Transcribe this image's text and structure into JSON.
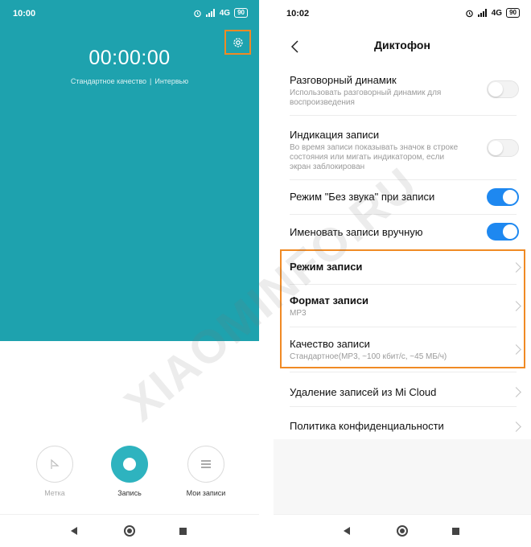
{
  "left": {
    "status": {
      "time": "10:00",
      "network": "4G",
      "battery": "90"
    },
    "timer": "00:00:00",
    "quality": "Стандартное качество",
    "separator": "|",
    "mode": "Интервью",
    "controls": {
      "mark": "Метка",
      "record": "Запись",
      "recordings": "Мои записи"
    },
    "colors": {
      "teal": "#1ea2ae",
      "record": "#2eb3bf",
      "highlight": "#f08a24"
    }
  },
  "right": {
    "status": {
      "time": "10:02",
      "network": "4G",
      "battery": "90"
    },
    "title": "Диктофон",
    "rows": [
      {
        "title": "Разговорный динамик",
        "subtitle": "Использовать разговорный динамик для воспроизведения",
        "toggle": false
      },
      {
        "title": "Индикация записи",
        "subtitle": "Во время записи показывать значок в строке состояния или мигать индикатором, если экран заблокирован",
        "toggle": false
      },
      {
        "title": "Режим \"Без звука\" при записи",
        "toggle": true
      },
      {
        "title": "Именовать записи вручную",
        "toggle": true
      },
      {
        "title": "Режим записи"
      },
      {
        "title": "Формат записи",
        "subtitle": "MP3"
      },
      {
        "title": "Качество записи",
        "subtitle": "Стандартное(MP3, ~100 кбит/с, ~45 МБ/ч)"
      },
      {
        "title": "Удаление записей из Mi Cloud"
      },
      {
        "title": "Политика конфиденциальности"
      }
    ],
    "colors": {
      "toggle_on": "#1e88f0",
      "highlight": "#f08a24"
    }
  },
  "watermark": "XIAOMINFO.RU"
}
